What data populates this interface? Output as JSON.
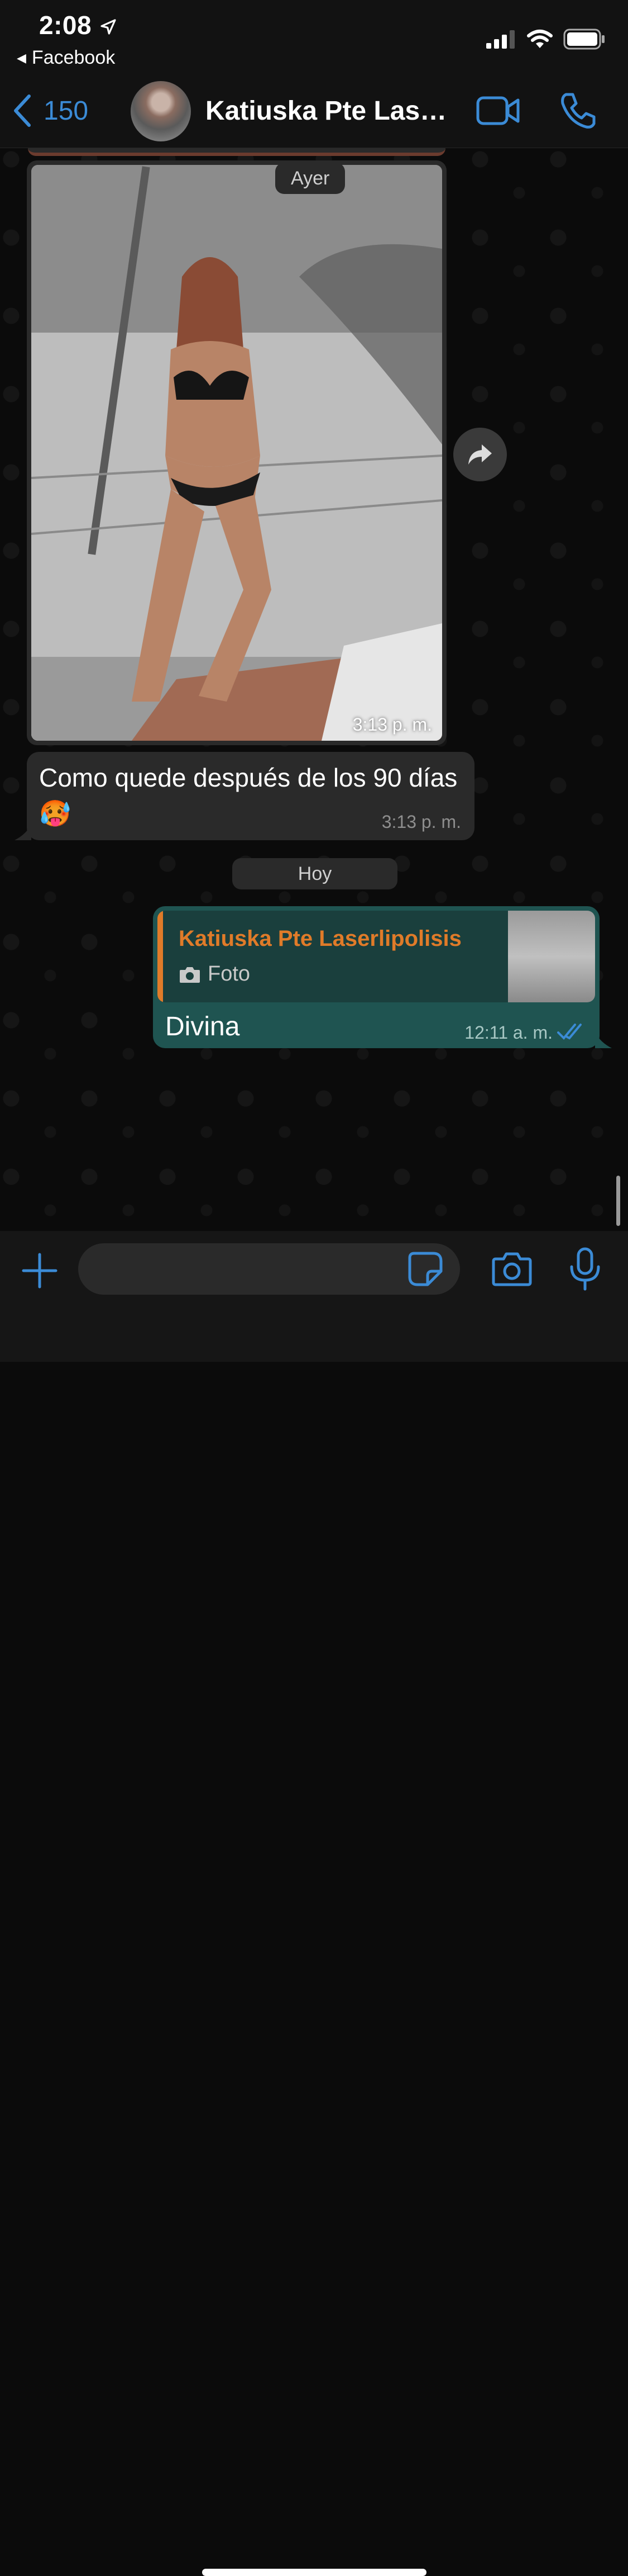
{
  "status_bar": {
    "time": "2:08",
    "back_app_label": "Facebook"
  },
  "nav": {
    "back_count": "150",
    "contact_name": "Katiuska Pte Lase..."
  },
  "messages": {
    "image_message": {
      "date_label": "Ayer",
      "time": "3:13 p. m."
    },
    "text_message": {
      "text": "Como quede después de los 90 días 🥵",
      "time": "3:13 p. m."
    },
    "today_label": "Hoy",
    "reply_message": {
      "quote_name": "Katiuska Pte Laserlipolisis",
      "quote_type": "Foto",
      "text": "Divina",
      "time": "12:11 a. m."
    }
  },
  "input": {
    "placeholder": ""
  },
  "colors": {
    "accent": "#3b8bd6",
    "outgoing_bubble": "#1f5451",
    "incoming_bubble": "#2a2a2a",
    "quote_accent": "#e07b29"
  },
  "icons": [
    "location-arrow-icon",
    "signal-icon",
    "wifi-icon",
    "battery-icon",
    "chevron-left-icon",
    "video-camera-icon",
    "phone-icon",
    "forward-icon",
    "camera-icon",
    "double-check-icon",
    "plus-icon",
    "sticker-icon",
    "microphone-icon"
  ]
}
